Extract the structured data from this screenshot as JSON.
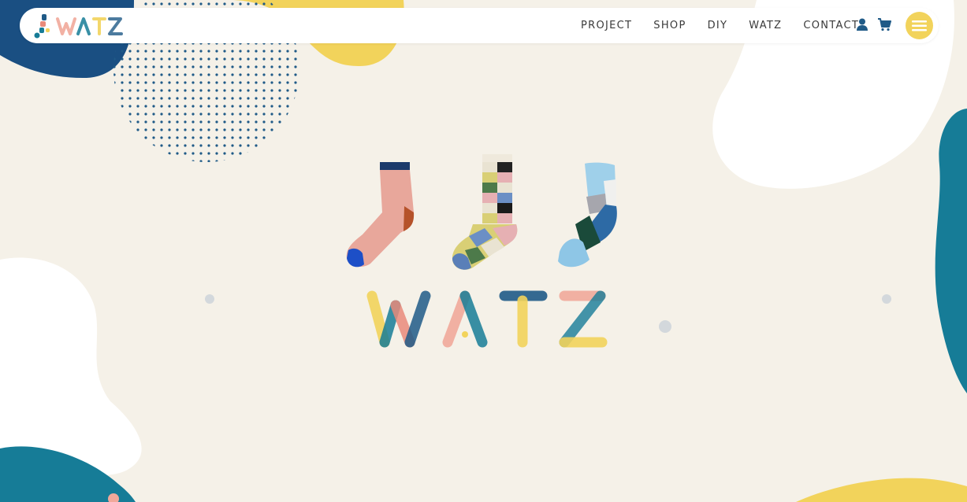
{
  "brand": {
    "logo_text": "WATZ",
    "colors": {
      "navy": "#1f5a87",
      "teal": "#167c97",
      "yellow": "#f2d35b",
      "pink": "#f1a89a",
      "cream": "#f5f1e8",
      "white": "#ffffff"
    }
  },
  "nav": {
    "items": [
      {
        "label": "PROJECT"
      },
      {
        "label": "SHOP"
      },
      {
        "label": "DIY"
      },
      {
        "label": "WATZ"
      },
      {
        "label": "CONTACT"
      }
    ],
    "user_icon": "user-icon",
    "cart_icon": "cart-icon",
    "menu_icon": "hamburger-menu-icon"
  },
  "hero": {
    "wordmark": "WATZ",
    "products": [
      "sock-pink",
      "sock-checkered",
      "sock-patchwork-blue"
    ]
  }
}
